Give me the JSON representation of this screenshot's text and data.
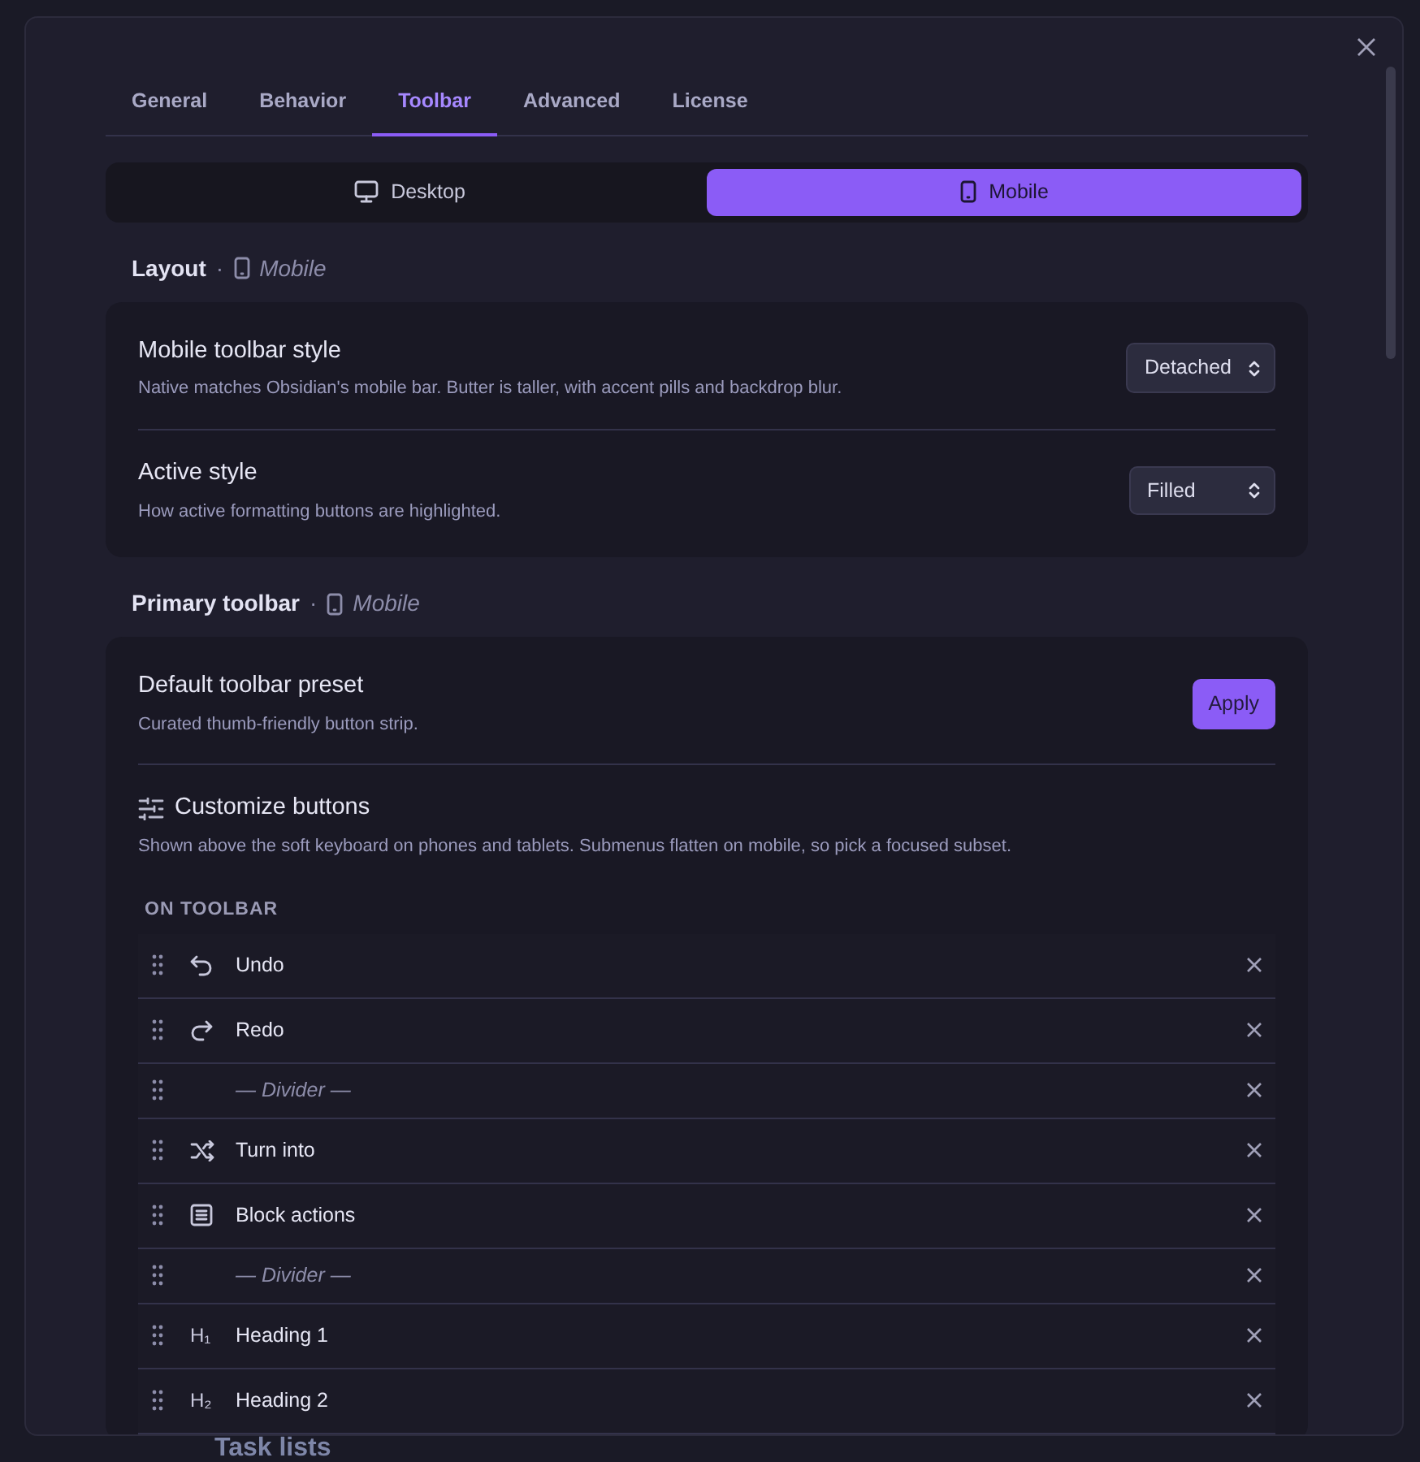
{
  "tabs": [
    {
      "label": "General",
      "selected": false
    },
    {
      "label": "Behavior",
      "selected": false
    },
    {
      "label": "Toolbar",
      "selected": true
    },
    {
      "label": "Advanced",
      "selected": false
    },
    {
      "label": "License",
      "selected": false
    }
  ],
  "segments": [
    {
      "label": "Desktop",
      "kind": "desktop",
      "selected": false
    },
    {
      "label": "Mobile",
      "kind": "mobile",
      "selected": true
    }
  ],
  "layout_section": {
    "title": "Layout",
    "separator": "·",
    "device": "Mobile",
    "settings": [
      {
        "name": "Mobile toolbar style",
        "description": "Native matches Obsidian's mobile bar. Butter is taller, with accent pills and backdrop blur.",
        "kind": "select",
        "value": "Detached"
      },
      {
        "name": "Active style",
        "description": "How active formatting buttons are highlighted.",
        "kind": "select",
        "value": "Filled"
      }
    ]
  },
  "primary_section": {
    "title": "Primary toolbar",
    "separator": "·",
    "device": "Mobile",
    "settings": [
      {
        "name": "Default toolbar preset",
        "description": "Curated thumb-friendly button strip.",
        "kind": "button",
        "value": "Apply"
      }
    ],
    "customize": {
      "title": "Customize buttons",
      "description": "Shown above the soft keyboard on phones and tablets. Submenus flatten on mobile, so pick a focused subset.",
      "list_label": "ON TOOLBAR",
      "items": [
        {
          "label": "Undo",
          "kind": "undo"
        },
        {
          "label": "Redo",
          "kind": "redo"
        },
        {
          "label": "— Divider —",
          "kind": "divider"
        },
        {
          "label": "Turn into",
          "kind": "shuffle"
        },
        {
          "label": "Block actions",
          "kind": "list"
        },
        {
          "label": "— Divider —",
          "kind": "divider"
        },
        {
          "label": "Heading 1",
          "kind": "heading",
          "glyph": "H₁"
        },
        {
          "label": "Heading 2",
          "kind": "heading",
          "glyph": "H₂"
        }
      ]
    }
  },
  "background_text": "Task lists"
}
